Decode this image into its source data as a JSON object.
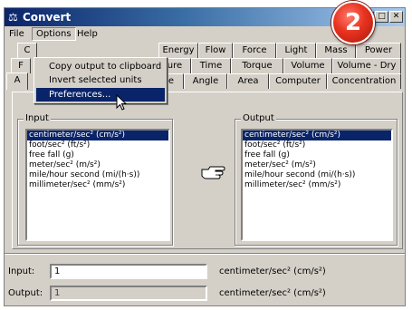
{
  "window": {
    "title": "Convert",
    "app_icon": "scales-icon"
  },
  "badge": {
    "number": "2",
    "color": "#e8321f"
  },
  "titlebar_buttons": {
    "minimize": "_",
    "maximize": "□",
    "close": "✕"
  },
  "menubar": {
    "items": [
      "File",
      "Options",
      "Help"
    ]
  },
  "options_menu": {
    "items": [
      "Copy output to clipboard",
      "Invert selected units",
      "Preferences..."
    ],
    "highlighted_index": 2
  },
  "tabs": {
    "row1": [
      "C",
      "Energy",
      "Flow",
      "Force",
      "Light",
      "Mass",
      "Power"
    ],
    "row2": [
      "F",
      "ure",
      "Time",
      "Torque",
      "Volume",
      "Volume - Dry"
    ],
    "row3": [
      "A",
      "e",
      "Angle",
      "Area",
      "Computer",
      "Concentration"
    ]
  },
  "input_group": {
    "label": "Input",
    "units": [
      "centimeter/sec² (cm/s²)",
      "foot/sec² (ft/s²)",
      "free fall (g)",
      "meter/sec² (m/s²)",
      "mile/hour second (mi/(h·s))",
      "millimeter/sec² (mm/s²)"
    ],
    "selected_index": 0
  },
  "output_group": {
    "label": "Output",
    "units": [
      "centimeter/sec² (cm/s²)",
      "foot/sec² (ft/s²)",
      "free fall (g)",
      "meter/sec² (m/s²)",
      "mile/hour second (mi/(h·s))",
      "millimeter/sec² (mm/s²)"
    ],
    "selected_index": 0
  },
  "convert_icon": "pointing-hand-icon",
  "fields": {
    "input_label": "Input:",
    "input_value": "1",
    "input_unit": "centimeter/sec² (cm/s²)",
    "output_label": "Output:",
    "output_value": "1",
    "output_unit": "centimeter/sec² (cm/s²)"
  },
  "colors": {
    "titlebar": "#0a246a",
    "selection": "#0a246a",
    "face": "#d4d0c8"
  }
}
